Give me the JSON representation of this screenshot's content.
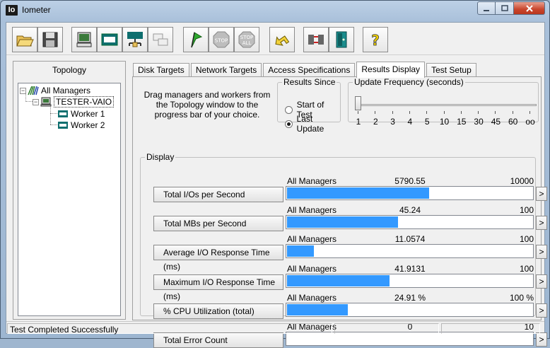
{
  "window": {
    "title": "Iometer",
    "app_icon_text": "Io"
  },
  "toolbar": {
    "buttons": [
      {
        "name": "open-icon"
      },
      {
        "name": "save-icon"
      },
      {
        "name": "new-manager-icon"
      },
      {
        "name": "new-disk-worker-icon"
      },
      {
        "name": "new-network-worker-icon"
      },
      {
        "name": "copy-worker-icon"
      },
      {
        "name": "start-flag-icon"
      },
      {
        "name": "stop-icon",
        "label": "STOP"
      },
      {
        "name": "stop-all-icon",
        "label": "STOP",
        "label2": "ALL"
      },
      {
        "name": "reset-workers-icon"
      },
      {
        "name": "exit-icon"
      },
      {
        "name": "about-icon",
        "label": "?"
      }
    ]
  },
  "topology": {
    "title": "Topology",
    "root": "All Managers",
    "manager": "TESTER-VAIO",
    "workers": [
      "Worker 1",
      "Worker 2"
    ]
  },
  "tabs": [
    {
      "label": "Disk Targets"
    },
    {
      "label": "Network Targets"
    },
    {
      "label": "Access Specifications"
    },
    {
      "label": "Results Display",
      "active": true
    },
    {
      "label": "Test Setup"
    }
  ],
  "results": {
    "instructions": "Drag managers and workers from the Topology window to the progress bar of your choice.",
    "results_since": {
      "legend": "Results Since",
      "options": [
        "Start of Test",
        "Last Update"
      ],
      "selected": "Last Update"
    },
    "update_frequency": {
      "legend": "Update Frequency (seconds)",
      "ticks": [
        "1",
        "2",
        "3",
        "4",
        "5",
        "10",
        "15",
        "30",
        "45",
        "60",
        "oo"
      ],
      "selected": "1"
    },
    "display_legend": "Display",
    "metrics": [
      {
        "label": "Total I/Os per Second",
        "manager": "All Managers",
        "value": "5790.55",
        "max": "10000",
        "fraction": 0.579
      },
      {
        "label": "Total MBs per Second",
        "manager": "All Managers",
        "value": "45.24",
        "max": "100",
        "fraction": 0.4524
      },
      {
        "label": "Average I/O Response Time (ms)",
        "manager": "All Managers",
        "value": "11.0574",
        "max": "100",
        "fraction": 0.1106
      },
      {
        "label": "Maximum I/O Response Time (ms)",
        "manager": "All Managers",
        "value": "41.9131",
        "max": "100",
        "fraction": 0.4191
      },
      {
        "label": "% CPU Utilization (total)",
        "manager": "All Managers",
        "value": "24.91 %",
        "max": "100 %",
        "fraction": 0.2491
      },
      {
        "label": "Total Error Count",
        "manager": "All Managers",
        "value": "0",
        "max": "10",
        "fraction": 0
      }
    ],
    "arrow_label": ">"
  },
  "status": {
    "text": "Test Completed Successfully"
  },
  "colors": {
    "meter_fill": "#3399ff"
  }
}
